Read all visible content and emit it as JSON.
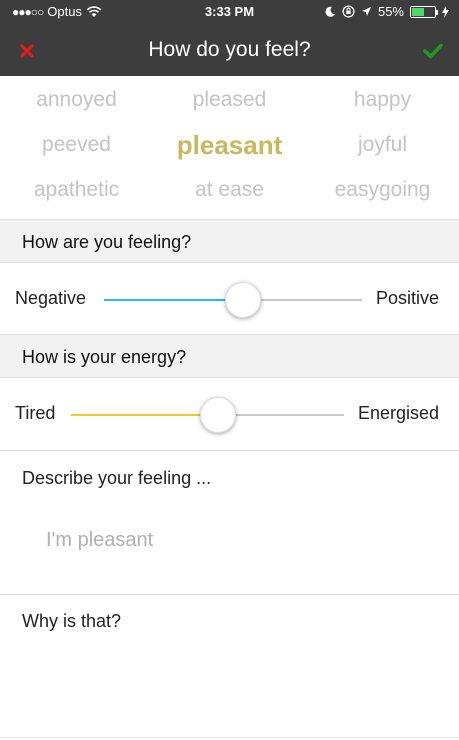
{
  "status_bar": {
    "carrier": "Optus",
    "time": "3:33 PM",
    "battery": "55%",
    "battery_level": 0.55,
    "icons": [
      "signal-dots-icon",
      "wifi-icon",
      "moon-icon",
      "lock-rotation-icon",
      "location-arrow-icon",
      "battery-icon",
      "charging-bolt-icon"
    ]
  },
  "nav": {
    "title": "How do you feel?",
    "close_icon": "close-icon",
    "done_icon": "checkmark-icon",
    "colors": {
      "close": "#e21b1b",
      "done": "#1f9a1f",
      "background": "#3d3d3d"
    }
  },
  "feelings": {
    "words": [
      "annoyed",
      "pleased",
      "happy",
      "peeved",
      "pleasant",
      "joyful",
      "apathetic",
      "at ease",
      "easygoing"
    ],
    "selected": "pleasant",
    "selected_color": "#c9b860"
  },
  "mood": {
    "question": "How are you feeling?",
    "min_label": "Negative",
    "max_label": "Positive",
    "value": 0.54,
    "fill_color": "#2bbbe8"
  },
  "energy": {
    "question": "How is your energy?",
    "min_label": "Tired",
    "max_label": "Energised",
    "value": 0.54,
    "fill_color": "#f4c62a"
  },
  "describe": {
    "label": "Describe your feeling ...",
    "placeholder": "I'm pleasant"
  },
  "reason": {
    "label": "Why is that?"
  }
}
